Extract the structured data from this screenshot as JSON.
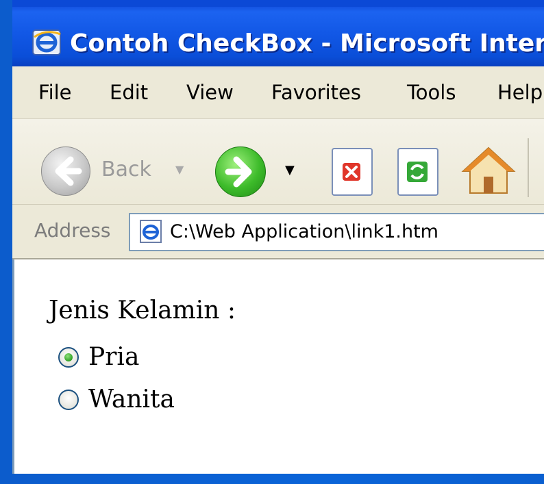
{
  "window": {
    "title": "Contoh CheckBox - Microsoft Interr"
  },
  "menu": {
    "items": [
      {
        "label": "File"
      },
      {
        "label": "Edit"
      },
      {
        "label": "View"
      },
      {
        "label": "Favorites"
      },
      {
        "label": "Tools"
      },
      {
        "label": "Help"
      }
    ]
  },
  "toolbar": {
    "back_label": "Back",
    "icons": [
      "back-arrow-icon",
      "forward-arrow-icon",
      "stop-icon",
      "refresh-icon",
      "home-icon"
    ]
  },
  "address": {
    "label": "Address",
    "value": "C:\\Web Application\\link1.htm"
  },
  "form": {
    "label": "Jenis Kelamin :",
    "options": [
      {
        "label": "Pria",
        "checked": true
      },
      {
        "label": "Wanita",
        "checked": false
      }
    ]
  },
  "colors": {
    "titlebar": "#1258e6",
    "chrome": "#ece9d8",
    "radio_checked": "#2fa024"
  }
}
